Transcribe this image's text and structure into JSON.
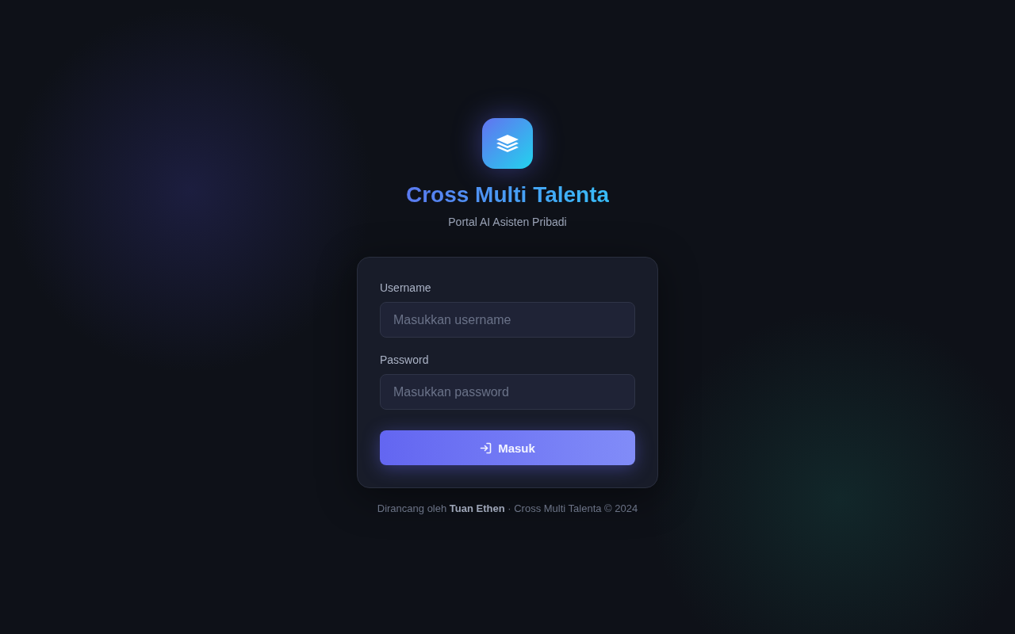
{
  "brand": {
    "title": "Cross Multi Talenta",
    "subtitle": "Portal AI Asisten Pribadi"
  },
  "form": {
    "fields": [
      {
        "label": "Username",
        "placeholder": "Masukkan username"
      },
      {
        "label": "Password",
        "placeholder": "Masukkan password"
      }
    ],
    "submit": {
      "label": "Masuk"
    }
  },
  "footer": {
    "text": "Dirancang oleh **Tuan Ethen** · Cross Multi Talenta © 2024"
  }
}
